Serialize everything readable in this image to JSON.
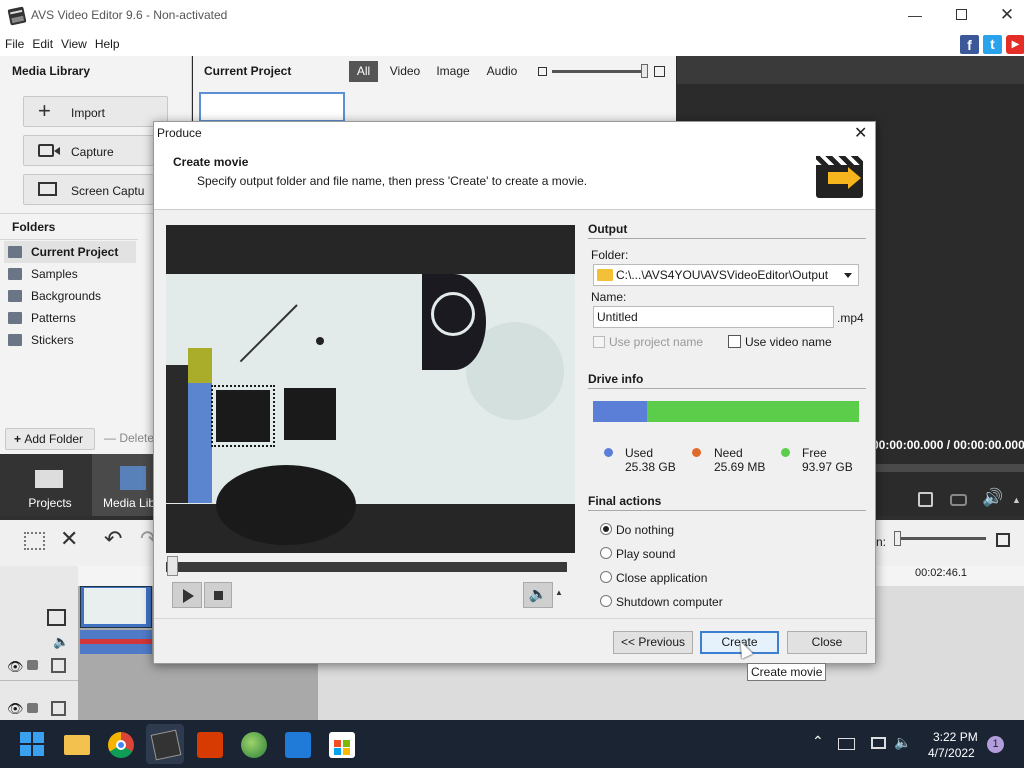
{
  "window": {
    "title": "AVS Video Editor 9.6 - Non-activated"
  },
  "menu": [
    "File",
    "Edit",
    "View",
    "Help"
  ],
  "social": {
    "facebook": "f",
    "twitter": "t",
    "youtube": "▶"
  },
  "media_library": {
    "title": "Media Library",
    "import": "Import",
    "capture": "Capture",
    "screen_capture": "Screen Captu",
    "folders_title": "Folders",
    "folders": [
      "Current Project",
      "Samples",
      "Backgrounds",
      "Patterns",
      "Stickers"
    ],
    "add_folder": "Add Folder",
    "delete": "Delete"
  },
  "project": {
    "title": "Current Project",
    "tabs": [
      "All",
      "Video",
      "Image",
      "Audio"
    ],
    "zoom_level": 0.97
  },
  "bottom_tabs": {
    "projects": "Projects",
    "media_library": "Media Libra"
  },
  "player": {
    "time": "00:00:00.000 / 00:00:00.000",
    "zoom_label": "n:",
    "duration": "00:02:46.1"
  },
  "dialog": {
    "title": "Produce",
    "heading": "Create movie",
    "subheading": "Specify output folder and file name, then press 'Create' to create a movie.",
    "output_title": "Output",
    "folder_label": "Folder:",
    "folder_value": "C:\\...\\AVS4YOU\\AVSVideoEditor\\Output",
    "name_label": "Name:",
    "name_value": "Untitled",
    "ext": ".mp4",
    "use_project_name": "Use project name",
    "use_video_name": "Use video name",
    "drive_title": "Drive info",
    "drive_used_fraction": 0.2033,
    "used_label": "Used",
    "used_value": "25.38 GB",
    "need_label": "Need",
    "need_value": "25.69 MB",
    "free_label": "Free",
    "free_value": "93.97 GB",
    "final_title": "Final actions",
    "actions": [
      "Do nothing",
      "Play sound",
      "Close application",
      "Shutdown computer"
    ],
    "selected_action": "Do nothing",
    "prev_button": "<< Previous",
    "create_button": "Create",
    "close_button": "Close",
    "tooltip": "Create movie",
    "colors": {
      "used": "#5b7fd6",
      "free": "#5ccc4b",
      "need": "#e06a2c"
    }
  },
  "taskbar": {
    "time": "3:22 PM",
    "date": "4/7/2022",
    "notifications": "1"
  }
}
